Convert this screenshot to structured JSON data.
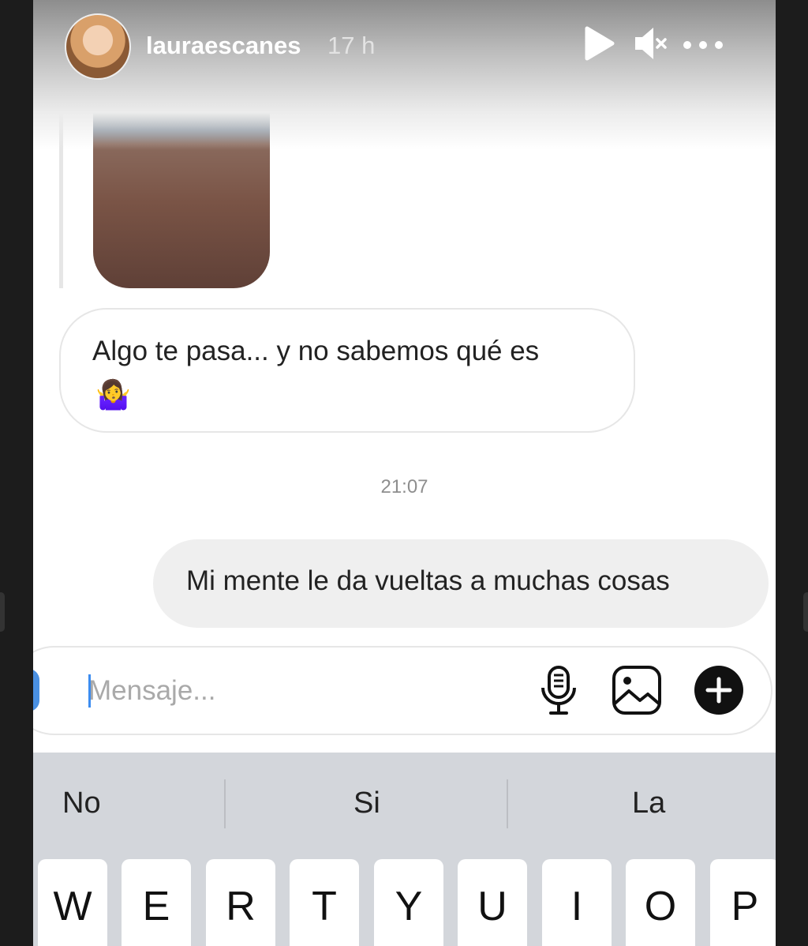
{
  "story": {
    "username": "lauraescanes",
    "time": "17 h",
    "controls": {
      "play_icon": "play-icon",
      "mute_icon": "mute-icon",
      "more_icon": "more-icon"
    }
  },
  "conversation": {
    "image_message": {
      "alt": "beach-sunset-photo"
    },
    "incoming": {
      "text": "Algo te pasa... y no sabemos qué es",
      "emoji": "🤷‍♀️"
    },
    "timestamp": "21:07",
    "outgoing": {
      "text": "Mi mente le da vueltas a muchas cosas"
    }
  },
  "composer": {
    "placeholder": "Mensaje...",
    "icons": [
      "microphone-icon",
      "gallery-icon",
      "plus-icon"
    ]
  },
  "keyboard": {
    "suggestions": [
      "No",
      "Si",
      "La"
    ],
    "row": [
      "W",
      "E",
      "R",
      "T",
      "Y",
      "U",
      "I",
      "O",
      "P"
    ]
  },
  "colors": {
    "accent": "#3c8cf0",
    "bubble_out": "#efefef",
    "keyboard": "#d3d6db"
  }
}
